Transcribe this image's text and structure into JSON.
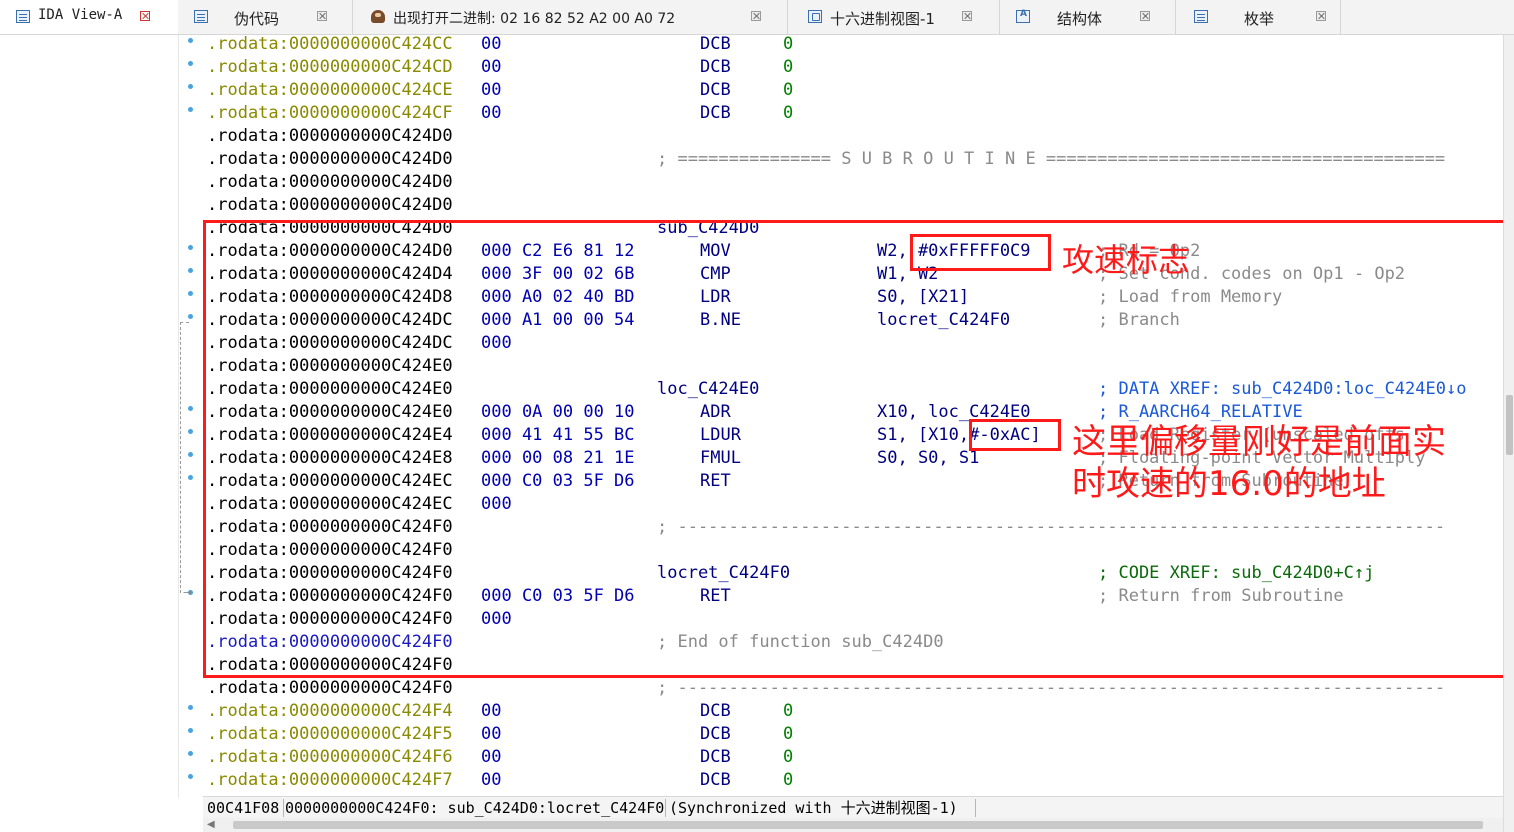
{
  "tabs": [
    {
      "label": "IDA View-A",
      "icon": "ida-view-icon",
      "active": true
    },
    {
      "label": "伪代码",
      "icon": "pseudocode-icon",
      "active": false
    },
    {
      "label": "出现打开二进制: 02 16 82 52 A2 00 A0 72",
      "icon": "user-avatar-icon",
      "active": false
    },
    {
      "label": "十六进制视图-1",
      "icon": "hex-view-icon",
      "active": false
    },
    {
      "label": "结构体",
      "icon": "structures-icon",
      "active": false
    },
    {
      "label": "枚举",
      "icon": "enums-icon",
      "active": false
    }
  ],
  "listing": {
    "rows": [
      {
        "addr": ".rodata:0000000000C424CC",
        "bytes": "00",
        "mnem": "DCB",
        "data": "0",
        "seg": "olive"
      },
      {
        "addr": ".rodata:0000000000C424CD",
        "bytes": "00",
        "mnem": "DCB",
        "data": "0",
        "seg": "olive"
      },
      {
        "addr": ".rodata:0000000000C424CE",
        "bytes": "00",
        "mnem": "DCB",
        "data": "0",
        "seg": "olive"
      },
      {
        "addr": ".rodata:0000000000C424CF",
        "bytes": "00",
        "mnem": "DCB",
        "data": "0",
        "seg": "olive"
      },
      {
        "addr": ".rodata:0000000000C424D0"
      },
      {
        "addr": ".rodata:0000000000C424D0",
        "sep": "; =============== S U B R O U T I N E ======================================="
      },
      {
        "addr": ".rodata:0000000000C424D0"
      },
      {
        "addr": ".rodata:0000000000C424D0"
      },
      {
        "addr": ".rodata:0000000000C424D0",
        "label": "sub_C424D0"
      },
      {
        "addr": ".rodata:0000000000C424D0",
        "bytes": "000 C2 E6 81 12",
        "mnem": "MOV",
        "ops": "W2, #0xFFFFF0C9",
        "comment": "; Rd = Op2"
      },
      {
        "addr": ".rodata:0000000000C424D4",
        "bytes": "000 3F 00 02 6B",
        "mnem": "CMP",
        "ops": "W1, W2",
        "comment": "; Set cond. codes on Op1 - Op2"
      },
      {
        "addr": ".rodata:0000000000C424D8",
        "bytes": "000 A0 02 40 BD",
        "mnem": "LDR",
        "ops": "S0, [X21]",
        "comment": "; Load from Memory"
      },
      {
        "addr": ".rodata:0000000000C424DC",
        "bytes": "000 A1 00 00 54",
        "mnem": "B.NE",
        "ops": "locret_C424F0",
        "comment": "; Branch"
      },
      {
        "addr": ".rodata:0000000000C424DC",
        "bytes": "000"
      },
      {
        "addr": ".rodata:0000000000C424E0"
      },
      {
        "addr": ".rodata:0000000000C424E0",
        "label": "loc_C424E0",
        "comment": "; DATA XREF: sub_C424D0:loc_C424E0↓o",
        "comment_style": "xref"
      },
      {
        "addr": ".rodata:0000000000C424E0",
        "bytes": "000 0A 00 00 10",
        "mnem": "ADR",
        "ops": "X10, loc_C424E0",
        "comment": "; R_AARCH64_RELATIVE",
        "comment_style": "xref"
      },
      {
        "addr": ".rodata:0000000000C424E4",
        "bytes": "000 41 41 55 BC",
        "mnem": "LDUR",
        "ops": "S1, [X10,#-0xAC]",
        "comment": "; Load Register (unscaled offs"
      },
      {
        "addr": ".rodata:0000000000C424E8",
        "bytes": "000 00 08 21 1E",
        "mnem": "FMUL",
        "ops": "S0, S0, S1",
        "comment": "; Floating-point Vector Multiply"
      },
      {
        "addr": ".rodata:0000000000C424EC",
        "bytes": "000 C0 03 5F D6",
        "mnem": "RET",
        "comment": "; Return from Subroutine"
      },
      {
        "addr": ".rodata:0000000000C424EC",
        "bytes": "000"
      },
      {
        "addr": ".rodata:0000000000C424F0",
        "sep": "; ---------------------------------------------------------------------------"
      },
      {
        "addr": ".rodata:0000000000C424F0"
      },
      {
        "addr": ".rodata:0000000000C424F0",
        "label": "locret_C424F0",
        "comment": "; CODE XREF: sub_C424D0+C↑j",
        "comment_style": "code"
      },
      {
        "addr": ".rodata:0000000000C424F0",
        "bytes": "000 C0 03 5F D6",
        "mnem": "RET",
        "comment": "; Return from Subroutine"
      },
      {
        "addr": ".rodata:0000000000C424F0",
        "bytes": "000"
      },
      {
        "addr": ".rodata:0000000000C424F0",
        "sep": "; End of function sub_C424D0",
        "seg": "blue"
      },
      {
        "addr": ".rodata:0000000000C424F0"
      },
      {
        "addr": ".rodata:0000000000C424F0",
        "sep": "; ---------------------------------------------------------------------------"
      },
      {
        "addr": ".rodata:0000000000C424F4",
        "bytes": "00",
        "mnem": "DCB",
        "data": "0",
        "seg": "olive"
      },
      {
        "addr": ".rodata:0000000000C424F5",
        "bytes": "00",
        "mnem": "DCB",
        "data": "0",
        "seg": "olive"
      },
      {
        "addr": ".rodata:0000000000C424F6",
        "bytes": "00",
        "mnem": "DCB",
        "data": "0",
        "seg": "olive"
      },
      {
        "addr": ".rodata:0000000000C424F7",
        "bytes": "00",
        "mnem": "DCB",
        "data": "0",
        "seg": "olive"
      }
    ]
  },
  "annotations": {
    "attack_speed_flag": "攻速标志",
    "offset_note_line1": "这里偏移量刚好是前面实",
    "offset_note_line2": "时攻速的16.0的地址"
  },
  "status_bar": {
    "offset": "00C41F08",
    "location": "0000000000C424F0: sub_C424D0:locret_C424F0",
    "sync": "(Synchronized with 十六进制视图-1)"
  },
  "colors": {
    "annotation_red": "#ff1a1a",
    "data_segment_olive": "#8a8a00",
    "bytes_blue": "#0000b0",
    "number_green": "#008000",
    "comment_gray": "#8a8a8a"
  }
}
